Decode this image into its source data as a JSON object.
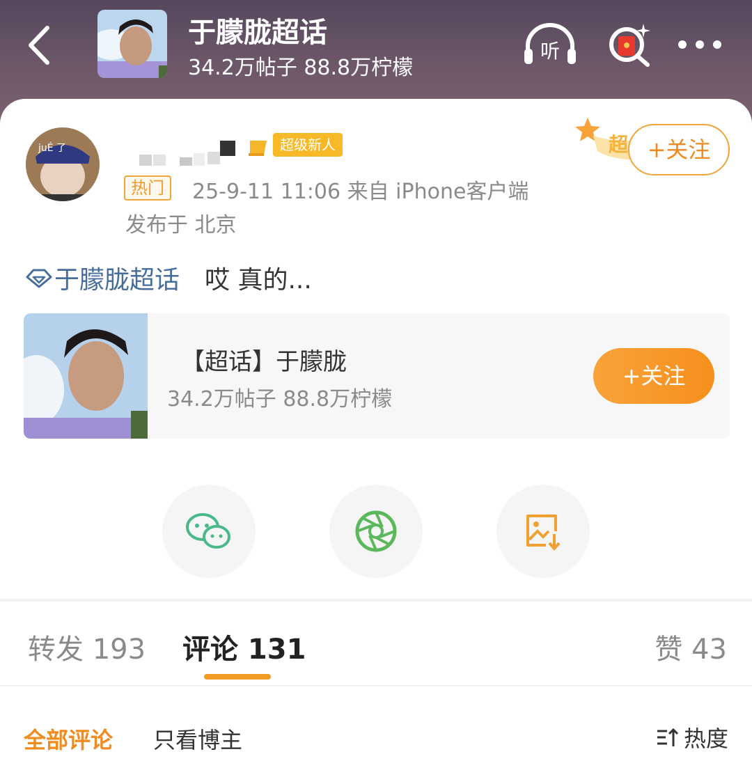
{
  "header": {
    "title": "于朦胧超话",
    "stats": "34.2万帖子 88.8万柠檬"
  },
  "post": {
    "badge": "超级新人",
    "hot_tag": "热门",
    "meta": "25-9-11 11:06 来自 iPhone客户端",
    "location": "发布于 北京",
    "follow_label": "+关注",
    "chao_deco_text": "超",
    "avatar_text": "juÉ 了",
    "topic": "于朦胧超话",
    "text": "哎 真的..."
  },
  "chao_card": {
    "title": "【超话】于朦胧",
    "stats": "34.2万帖子 88.8万柠檬",
    "follow_label": "+关注"
  },
  "tabs": {
    "forward": "转发 193",
    "comment": "评论 131",
    "like": "赞 43"
  },
  "comments": {
    "all": "全部评论",
    "blogger_only": "只看博主",
    "sort": "热度"
  },
  "icons": {
    "listen": "听",
    "colors": {
      "accent": "#f19b22",
      "link": "#476e9b",
      "wechat": "#49b98a",
      "moments": "#5cb85c"
    }
  }
}
